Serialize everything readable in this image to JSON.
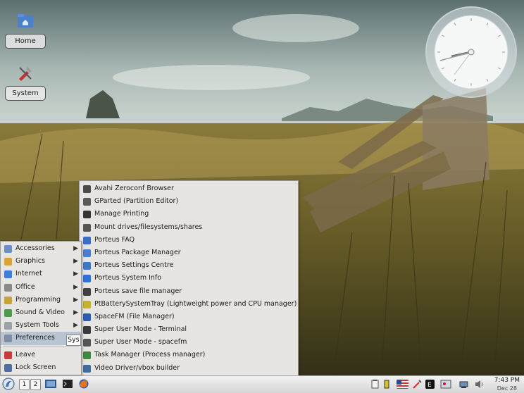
{
  "desktop": {
    "icons": [
      {
        "label": "Home"
      },
      {
        "label": "System"
      }
    ]
  },
  "start_menu": {
    "items": [
      {
        "label": "Accessories",
        "icon": "accessories-icon",
        "color": "#6a8fc4"
      },
      {
        "label": "Graphics",
        "icon": "graphics-icon",
        "color": "#d9a23a"
      },
      {
        "label": "Internet",
        "icon": "internet-icon",
        "color": "#3d7ed6"
      },
      {
        "label": "Office",
        "icon": "office-icon",
        "color": "#8a8a8a"
      },
      {
        "label": "Programming",
        "icon": "programming-icon",
        "color": "#c6a43a"
      },
      {
        "label": "Sound & Video",
        "icon": "sound-video-icon",
        "color": "#4c9a4c"
      },
      {
        "label": "System Tools",
        "icon": "system-tools-icon",
        "color": "#9aa1a8"
      },
      {
        "label": "Preferences",
        "icon": "preferences-icon",
        "color": "#7c8fa6",
        "active": true
      },
      {
        "label": "Leave",
        "icon": "leave-icon",
        "color": "#c93a3a"
      },
      {
        "label": "Lock Screen",
        "icon": "lock-screen-icon",
        "color": "#4d6fa3"
      }
    ],
    "tooltip_fragment": "Sys"
  },
  "submenu": {
    "items": [
      {
        "label": "Avahi Zeroconf Browser",
        "icon": "avahi-icon",
        "color": "#4a4a4a"
      },
      {
        "label": "GParted (Partition Editor)",
        "icon": "gparted-icon",
        "color": "#5a5a5a"
      },
      {
        "label": "Manage Printing",
        "icon": "printer-icon",
        "color": "#333333"
      },
      {
        "label": "Mount drives/filesystems/shares",
        "icon": "mount-icon",
        "color": "#555555"
      },
      {
        "label": "Porteus FAQ",
        "icon": "porteus-faq-icon",
        "color": "#3a6fc4"
      },
      {
        "label": "Porteus Package Manager",
        "icon": "package-manager-icon",
        "color": "#4a7fd0"
      },
      {
        "label": "Porteus Settings Centre",
        "icon": "settings-centre-icon",
        "color": "#3c78c8"
      },
      {
        "label": "Porteus System Info",
        "icon": "info-icon",
        "color": "#2f6fd6"
      },
      {
        "label": "Porteus save file manager",
        "icon": "save-file-icon",
        "color": "#404040"
      },
      {
        "label": "PtBatterySystemTray (Lightweight power and CPU manager)",
        "icon": "battery-icon",
        "color": "#c9b12a"
      },
      {
        "label": "SpaceFM (File Manager)",
        "icon": "spacefm-icon",
        "color": "#2d5db8"
      },
      {
        "label": "Super User Mode - Terminal",
        "icon": "terminal-icon",
        "color": "#3a3a3a"
      },
      {
        "label": "Super User Mode - spacefm",
        "icon": "spacefm-su-icon",
        "color": "#555555"
      },
      {
        "label": "Task Manager (Process manager)",
        "icon": "task-manager-icon",
        "color": "#3d8c3d"
      },
      {
        "label": "Video Driver/vbox builder",
        "icon": "video-driver-icon",
        "color": "#3f6b9e"
      }
    ]
  },
  "taskbar": {
    "pagers": [
      "1",
      "2"
    ],
    "clock_time": "7:43 PM",
    "clock_date": "Dec 28"
  }
}
